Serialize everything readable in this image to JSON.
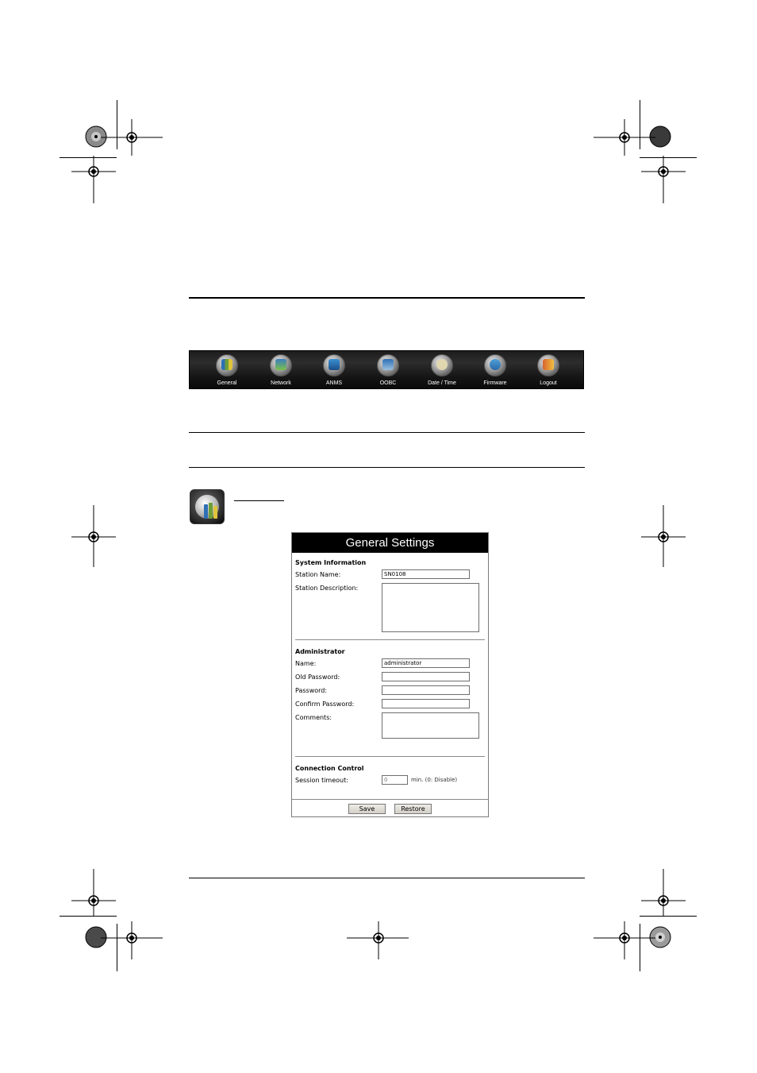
{
  "toolbar": {
    "items": [
      {
        "label": "General",
        "icon": "general-icon",
        "color": "#6c9e3a"
      },
      {
        "label": "Network",
        "icon": "network-icon",
        "color": "#3a7fbf"
      },
      {
        "label": "ANMS",
        "icon": "anms-icon",
        "color": "#3b8fd1"
      },
      {
        "label": "OOBC",
        "icon": "oobc-icon",
        "color": "#2f6fb5"
      },
      {
        "label": "Date / Time",
        "icon": "clock-icon",
        "color": "#e0d7b0"
      },
      {
        "label": "Firmware",
        "icon": "firmware-icon",
        "color": "#4fa0d8"
      },
      {
        "label": "Logout",
        "icon": "logout-icon",
        "color": "#d9622b"
      }
    ]
  },
  "general_settings": {
    "title": "General Settings",
    "system_information": {
      "heading": "System Information",
      "station_name_label": "Station Name:",
      "station_name_value": "SN0108",
      "station_description_label": "Station Description:",
      "station_description_value": ""
    },
    "administrator": {
      "heading": "Administrator",
      "name_label": "Name:",
      "name_value": "administrator",
      "old_password_label": "Old Password:",
      "password_label": "Password:",
      "confirm_password_label": "Confirm Password:",
      "comments_label": "Comments:"
    },
    "connection_control": {
      "heading": "Connection Control",
      "session_timeout_label": "Session timeout:",
      "session_timeout_value": "0",
      "session_timeout_hint": "min.  (0: Disable)"
    },
    "buttons": {
      "save": "Save",
      "restore": "Restore"
    }
  }
}
